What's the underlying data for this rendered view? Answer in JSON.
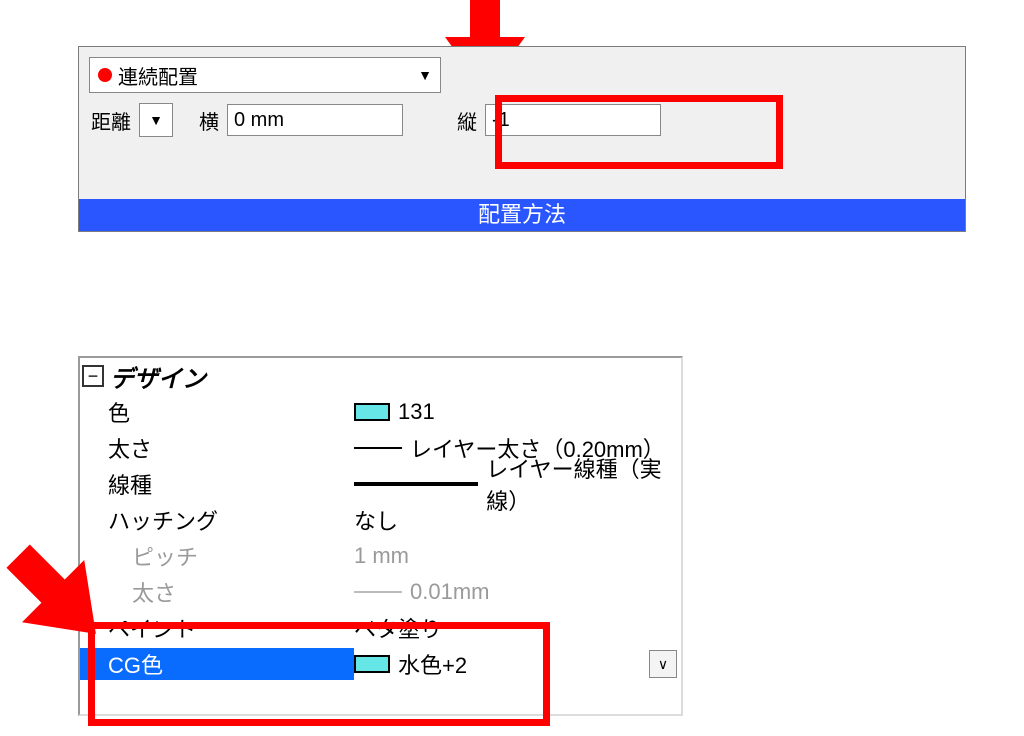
{
  "panel1": {
    "mode_label": "連続配置",
    "distance_label": "距離",
    "h_label": "横",
    "h_value": "0 mm",
    "v_label": "縦",
    "v_value": "-1",
    "footer": "配置方法"
  },
  "panel2": {
    "section": "デザイン",
    "toggle": "⊟",
    "rows": {
      "color": {
        "label": "色",
        "value": "131"
      },
      "thickness": {
        "label": "太さ",
        "value": "レイヤー太さ（0.20mm）"
      },
      "linetype": {
        "label": "線種",
        "value": "レイヤー線種（実線）"
      },
      "hatching": {
        "label": "ハッチング",
        "value": "なし"
      },
      "pitch": {
        "label": "ピッチ",
        "value": "1 mm"
      },
      "thick2": {
        "label": "太さ",
        "value": "0.01mm"
      },
      "paint": {
        "label": "ペイント",
        "value": "ベタ塗り"
      },
      "cgcolor": {
        "label": "CG色",
        "value": "水色+2"
      }
    }
  }
}
